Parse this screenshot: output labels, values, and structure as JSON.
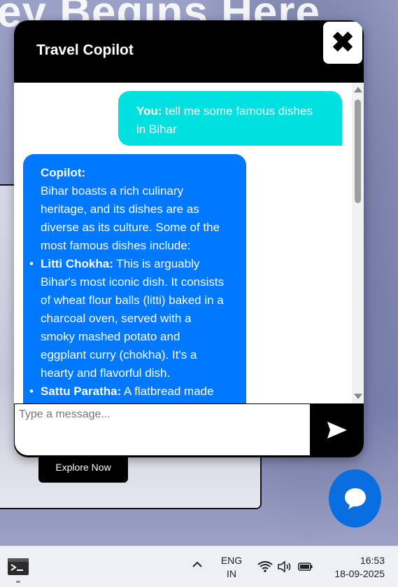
{
  "background": {
    "hero_title": "ey Begins Here",
    "explore_label": "Explore Now"
  },
  "chat": {
    "title": "Travel Copilot",
    "user_message": {
      "speaker": "You:",
      "text": " tell me some famous dishes in Bihar"
    },
    "bot_message": {
      "speaker": "Copilot:",
      "intro": "Bihar boasts a rich culinary heritage, and its dishes are as diverse as its culture. Some of the most famous dishes include:",
      "items": [
        {
          "name": "Litti Chokha:",
          "text": " This is arguably Bihar's most iconic dish. It consists of wheat flour balls (litti) baked in a charcoal oven, served with a smoky mashed potato and eggplant curry (chokha). It's a hearty and flavorful dish."
        },
        {
          "name": "Sattu Paratha:",
          "text": " A flatbread made"
        }
      ]
    },
    "input_placeholder": "Type a message..."
  },
  "taskbar": {
    "lang_line1": "ENG",
    "lang_line2": "IN",
    "time": "16:53",
    "date": "18-09-2025"
  },
  "colors": {
    "user_bubble": "#00e0e0",
    "bot_bubble": "#0078ff",
    "header": "#000000",
    "fab": "#0a6de0"
  },
  "icons": [
    "close-icon",
    "send-icon",
    "chat-bubble-icon",
    "terminal-icon",
    "chevron-up-icon",
    "wifi-icon",
    "speaker-icon",
    "battery-icon"
  ]
}
